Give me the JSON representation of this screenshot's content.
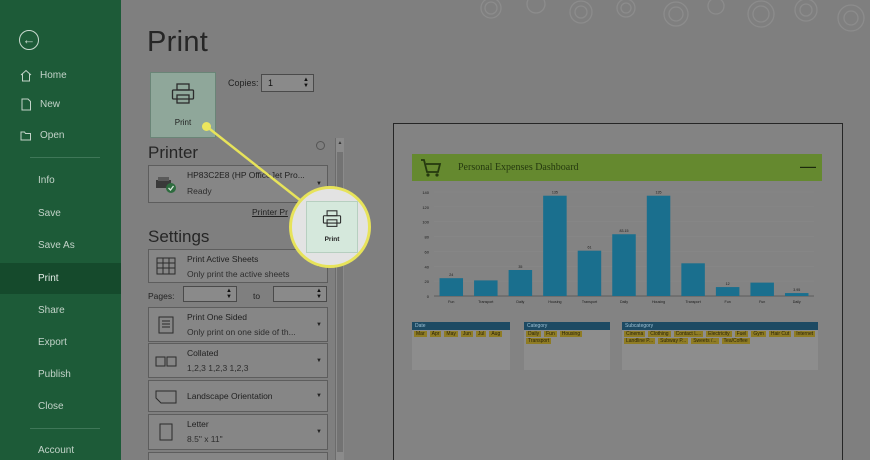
{
  "sidebar": {
    "items": [
      {
        "label": "Home",
        "icon": "home-icon"
      },
      {
        "label": "New",
        "icon": "new-document-icon"
      },
      {
        "label": "Open",
        "icon": "open-folder-icon"
      },
      {
        "label": "Info"
      },
      {
        "label": "Save"
      },
      {
        "label": "Save As"
      },
      {
        "label": "Print"
      },
      {
        "label": "Share"
      },
      {
        "label": "Export"
      },
      {
        "label": "Publish"
      },
      {
        "label": "Close"
      },
      {
        "label": "Account"
      }
    ],
    "active": "Print"
  },
  "main": {
    "title": "Print",
    "print_button": "Print",
    "copies_label": "Copies:",
    "copies_value": "1",
    "printer_heading": "Printer",
    "printer_name": "HP83C2E8 (HP OfficeJet Pro...",
    "printer_status": "Ready",
    "printer_properties": "Printer Pr",
    "settings_heading": "Settings",
    "settings": [
      {
        "title": "Print Active Sheets",
        "sub": "Only print the active sheets"
      },
      {
        "title": "Print One Sided",
        "sub": "Only print on one side of th..."
      },
      {
        "title": "Collated",
        "sub": "1,2,3   1,2,3   1,2,3"
      },
      {
        "title": "Landscape Orientation",
        "sub": ""
      },
      {
        "title": "Letter",
        "sub": "8.5\" x 11\""
      }
    ],
    "pages_label": "Pages:",
    "to_label": "to"
  },
  "callout": {
    "button_label": "Print"
  },
  "preview": {
    "dashboard_title": "Personal Expenses Dashboard",
    "tables": [
      {
        "header": "Date",
        "cells": [
          "Mar",
          "Apr",
          "May",
          "Jun",
          "Jul",
          "Aug"
        ]
      },
      {
        "header": "Category",
        "cells": [
          "Daily",
          "Fun",
          "Housing",
          "Transport"
        ]
      },
      {
        "header": "Subcategory",
        "cells": [
          "Cinema",
          "Clothing",
          "Contact L...",
          "Electricity",
          "Fuel",
          "Gym",
          "Hair Cut",
          "Internet",
          "Landline P...",
          "Subway P...",
          "Sweets /...",
          "Tea/Coffee"
        ]
      }
    ]
  },
  "colors": {
    "sidebar": "#1d5b38",
    "accent_yellow": "#e7e35a",
    "bar": "#1a6f8e",
    "dash_header": "#65892f"
  },
  "chart_data": {
    "type": "bar",
    "categories": [
      "Fun",
      "Transport",
      "Daily",
      "Housing",
      "Transport",
      "Daily",
      "Housing",
      "Transport",
      "Fun",
      "Fun",
      "Daily"
    ],
    "values": [
      24,
      21,
      35,
      135,
      61,
      83.15,
      135,
      44,
      12,
      18,
      3.95
    ],
    "labels": [
      "24",
      "",
      "35",
      "135",
      "61",
      "83.15",
      "135",
      "",
      "12",
      "",
      "3.95"
    ],
    "ylim": [
      0,
      140
    ],
    "yticks": [
      0,
      20,
      40,
      60,
      80,
      100,
      120,
      140
    ]
  }
}
